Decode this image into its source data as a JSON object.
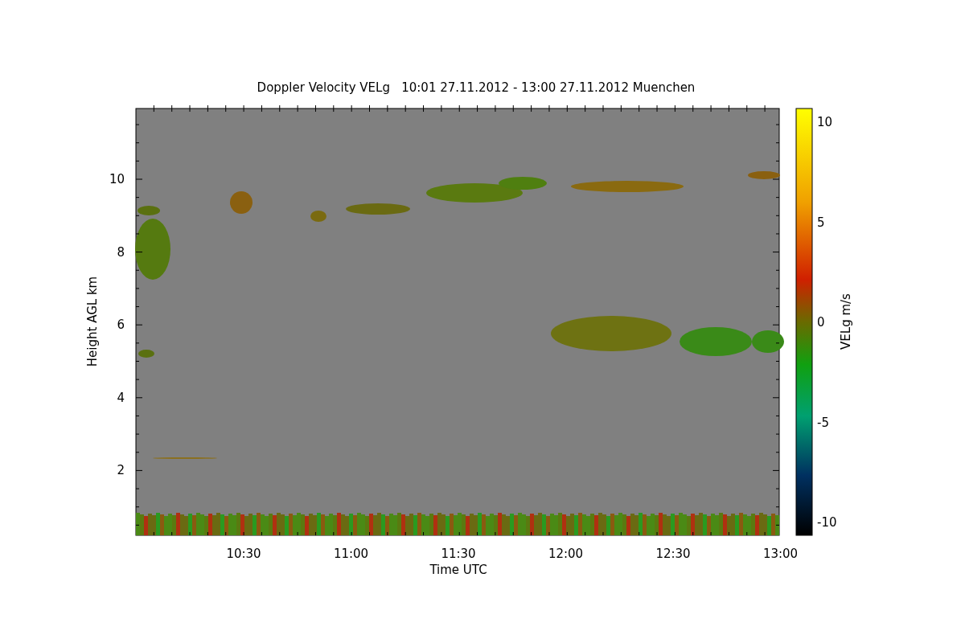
{
  "figure": {
    "title": "Doppler Velocity VELg   10:01 27.11.2012 - 13:00 27.11.2012 Muenchen",
    "xlabel": "Time UTC",
    "ylabel": "Height AGL km",
    "xticks": [
      "10:30",
      "11:00",
      "11:30",
      "12:00",
      "12:30",
      "13:00"
    ],
    "yticks": [
      "10",
      "8",
      "6",
      "4",
      "2"
    ],
    "colorbar": {
      "label": "VELg m/s",
      "ticks": [
        "10",
        "5",
        "0",
        "-5",
        "-10"
      ]
    }
  }
}
